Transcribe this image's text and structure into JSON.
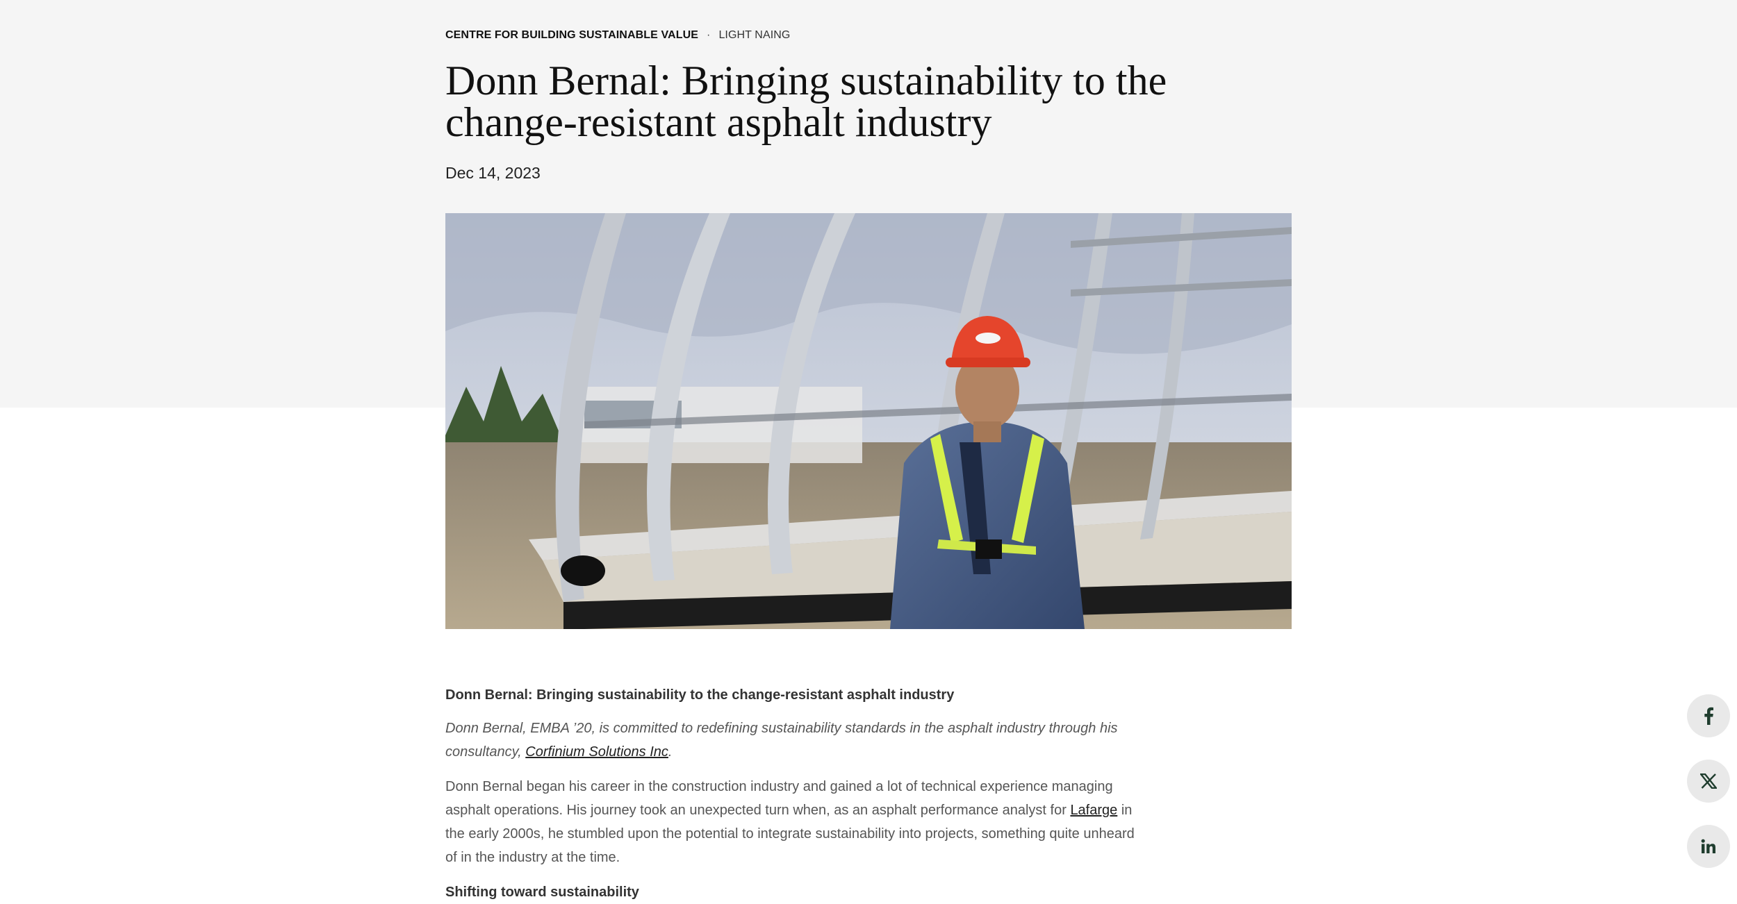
{
  "meta": {
    "category": "Centre for Building Sustainable Value",
    "separator": "·",
    "author": "Light Naing"
  },
  "article": {
    "headline": "Donn Bernal: Bringing sustainability to the change-resistant asphalt industry",
    "date": "Dec 14, 2023",
    "lead_title": "Donn Bernal: Bringing sustainability to the change-resistant asphalt industry",
    "intro_before": "Donn Bernal, EMBA ’20, is committed to redefining sustainability standards in the asphalt industry through his consultancy, ",
    "intro_link": "Corfinium Solutions Inc",
    "intro_after": ".",
    "body_before": "Donn Bernal began his career in the construction industry and gained a lot of technical experience managing asphalt operations. His journey took an unexpected turn when, as an asphalt performance analyst for ",
    "body_link": "Lafarge",
    "body_after": " in the early 2000s, he stumbled upon the potential to integrate sustainability into projects, something quite unheard of in the industry at the time.",
    "sub_heading": "Shifting toward sustainability"
  },
  "share": {
    "facebook_icon": "facebook-icon",
    "x_icon": "x-icon",
    "linkedin_icon": "linkedin-icon"
  },
  "colors": {
    "top_band": "#f5f5f5",
    "share_button_bg": "#e9e9e9",
    "icon": "#1f3d2e"
  }
}
